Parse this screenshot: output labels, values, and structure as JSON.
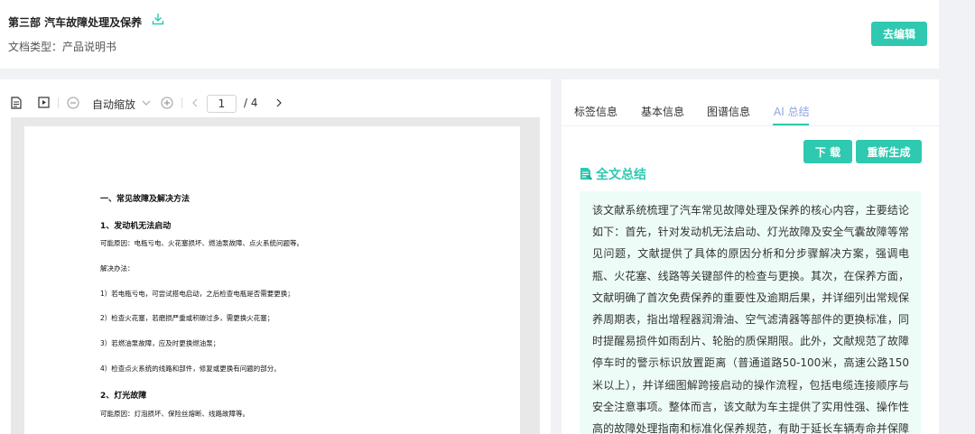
{
  "header": {
    "title": "第三部 汽车故障处理及保养",
    "doc_type": "文档类型：产品说明书",
    "edit_button": "去编辑"
  },
  "toolbar": {
    "zoom_label": "自动缩放",
    "current_page": "1",
    "total_pages": "/ 4"
  },
  "document": {
    "lines": [
      "一、常见故障及解决方法",
      "1、发动机无法启动",
      "可能原因：电瓶亏电、火花塞损坏、燃油泵故障、点火系统问题等。",
      "解决办法：",
      "1）若电瓶亏电，可尝试搭电启动，之后检查电瓶是否需要更换；",
      "2）检查火花塞，若磨损严重或积碳过多，需更换火花塞；",
      "3）若燃油泵故障，应及时更换燃油泵；",
      "4）检查点火系统的线路和部件，修复或更换有问题的部分。",
      "2、灯光故障",
      "可能原因：灯泡损坏、保险丝熔断、线路故障等。"
    ]
  },
  "tabs": [
    {
      "label": "标签信息"
    },
    {
      "label": "基本信息"
    },
    {
      "label": "图谱信息"
    },
    {
      "label": "AI 总结"
    }
  ],
  "summary": {
    "download_button": "下 载",
    "regenerate_button": "重新生成",
    "title": "全文总结",
    "text": "该文献系统梳理了汽车常见故障处理及保养的核心内容，主要结论如下：首先，针对发动机无法启动、灯光故障及安全气囊故障等常见问题，文献提供了具体的原因分析和分步骤解决方案，强调电瓶、火花塞、线路等关键部件的检查与更换。其次，在保养方面，文献明确了首次免费保养的重要性及逾期后果，并详细列出常规保养周期表，指出增程器润滑油、空气滤清器等部件的更换标准，同时提醒易损件如雨刮片、轮胎的质保期限。此外，文献规范了故障停车时的警示标识放置距离（普通道路50-100米，高速公路150米以上），并详细图解跨接启动的操作流程，包括电缆连接顺序与安全注意事项。整体而言，该文献为车主提供了实用性强、操作性高的故障处理指南和标准化保养规范，有助于延长车辆寿命并保障行车安全。"
  },
  "colors": {
    "accent": "#2ec9b0",
    "active_tab": "#8fa6e0",
    "summary_bg": "#eefcf7"
  }
}
